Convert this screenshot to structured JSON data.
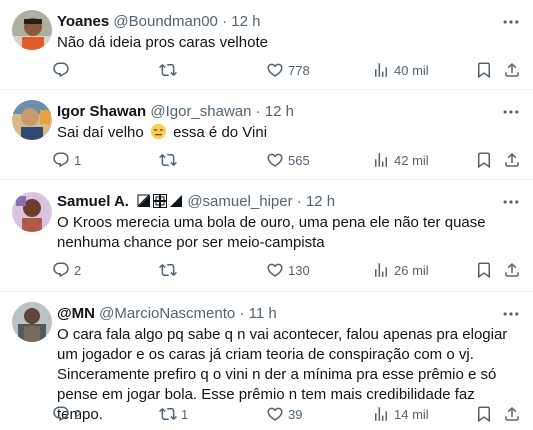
{
  "tweets": [
    {
      "name": "Yoanes",
      "handle": "@Boundman00",
      "dot": "·",
      "time": "12 h",
      "text": "Não dá ideia pros caras velhote",
      "replies": "",
      "retweets": "",
      "likes": "778",
      "views": "40 mil"
    },
    {
      "name": "Igor Shawan",
      "handle": "@Igor_shawan",
      "dot": "·",
      "time": "12 h",
      "text_before": "Sai daí velho",
      "text_after": "essa é do Vini",
      "emoji": "expressionless-face-emoji",
      "replies": "1",
      "retweets": "",
      "likes": "565",
      "views": "42 mil"
    },
    {
      "name": "Samuel A.",
      "handle": "@samuel_hiper",
      "dot": "·",
      "time": "12 h",
      "text": "O Kroos merecia uma bola de ouro, uma pena ele não ter quase nenhuma chance por ser meio-campista",
      "replies": "2",
      "retweets": "",
      "likes": "130",
      "views": "26 mil"
    },
    {
      "name": "@MN",
      "handle": "@MarcioNascmento",
      "dot": "·",
      "time": "11 h",
      "text": "O cara fala algo pq sabe q n vai acontecer, falou apenas pra elogiar um jogador e os caras já criam teoria de conspiração com o vj. Sinceramente prefiro q o vini n der a mínima pra esse prêmio e só pense em jogar bola. Esse prêmio n tem mais credibilidade faz tempo.",
      "replies": "2",
      "retweets": "1",
      "likes": "39",
      "views": "14 mil"
    }
  ],
  "icons": {
    "reply": "reply-icon",
    "retweet": "retweet-icon",
    "like": "heart-icon",
    "views": "views-icon",
    "bookmark": "bookmark-icon",
    "share": "share-icon",
    "more": "more-icon"
  },
  "colors": {
    "text": "#0f1419",
    "secondary": "#536471",
    "border": "#eff3f4"
  }
}
